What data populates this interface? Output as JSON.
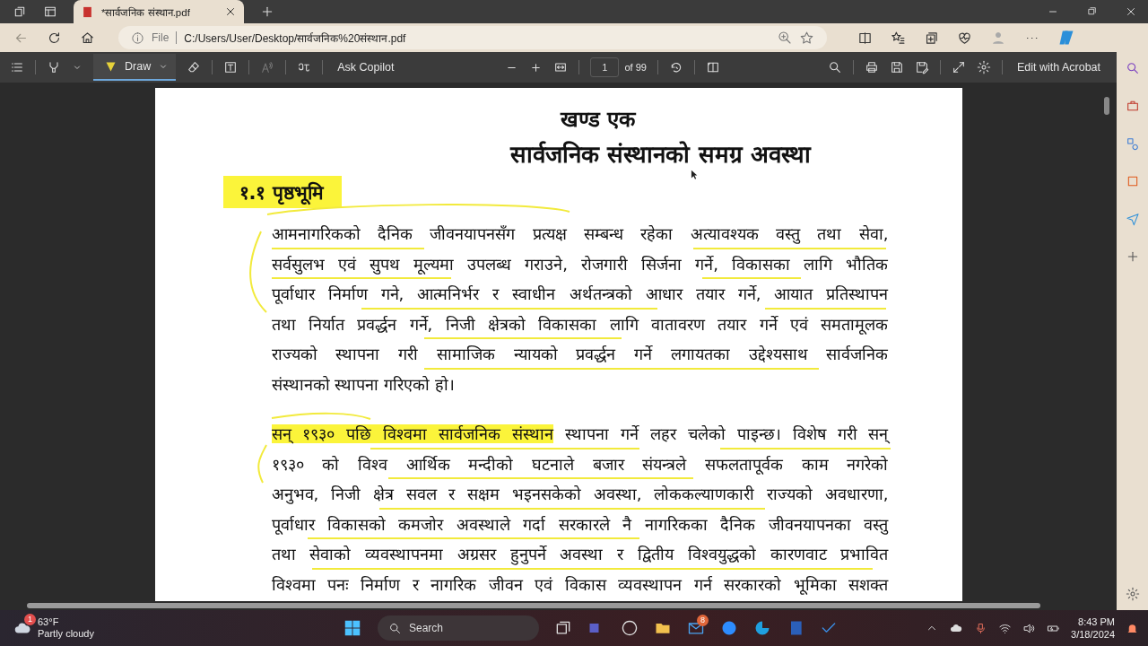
{
  "browser": {
    "tabs": [
      {
        "title": "*सार्वजनिक संस्थान.pdf",
        "selected": true
      }
    ],
    "address": {
      "scheme": "File",
      "url": "C:/Users/User/Desktop/सार्वजनिक%20संस्थान.pdf"
    }
  },
  "pdf_toolbar": {
    "draw": {
      "label": "Draw",
      "selected": true
    },
    "ask_copilot": "Ask Copilot",
    "page": "1",
    "page_count": "of 99",
    "edit_button": "Edit with Acrobat"
  },
  "document": {
    "headings": [
      "खण्ड एक",
      "सार्वजनिक संस्थानको समग्र अवस्था"
    ],
    "section": {
      "text": "१.१ पृष्ठभूमि",
      "highlighted": true
    },
    "paragraphs": [
      {
        "lines": [
          {
            "justified": true,
            "segments": [
              {
                "text": "आमनागरिकको दैनिक जीवनयापनसँग प्रत्यक्ष सम्बन्ध रहेका अत्यावश्यक वस्तु तथा सेवा,",
                "highlighted": false
              }
            ]
          },
          {
            "justified": true,
            "segments": [
              {
                "text": "सर्वसुलभ एवं सुपथ मूल्यमा उपलब्ध गराउने, रोजगारी सिर्जना गर्ने, विकासका लागि भौतिक",
                "highlighted": false
              }
            ]
          },
          {
            "justified": true,
            "segments": [
              {
                "text": "पूर्वाधार निर्माण गने, आत्मनिर्भर र स्वाधीन अर्थतन्त्रको आधार तयार गर्ने, आयात प्रतिस्थापन",
                "highlighted": false
              }
            ]
          },
          {
            "justified": true,
            "segments": [
              {
                "text": "तथा निर्यात प्रवर्द्धन गर्ने, निजी क्षेत्रको विकासका लागि वातावरण तयार गर्ने एवं समतामूलक",
                "highlighted": false
              }
            ]
          },
          {
            "justified": true,
            "segments": [
              {
                "text": "राज्यको स्थापना गरी सामाजिक न्यायको प्रवर्द्धन गर्ने लगायतका उद्देश्यसाथ सार्वजनिक",
                "highlighted": false
              }
            ]
          },
          {
            "justified": false,
            "segments": [
              {
                "text": "संस्थानको स्थापना गरिएको हो।",
                "highlighted": false
              }
            ]
          }
        ]
      },
      {
        "lines": [
          {
            "justified": true,
            "segments": [
              {
                "text": "सन् १९३० पछि विश्वमा सार्वजनिक संस्थान",
                "highlighted": true
              },
              {
                "text": "स्थापना गर्ने लहर चलेको पाइन्छ। विशेष गरी सन्",
                "highlighted": false
              }
            ]
          },
          {
            "justified": true,
            "segments": [
              {
                "text": "१९३० को विश्व आर्थिक मन्दीको घटनाले बजार संयन्त्रले सफलतापूर्वक काम नगरेको",
                "highlighted": false
              }
            ]
          },
          {
            "justified": true,
            "segments": [
              {
                "text": "अनुभव, निजी क्षेत्र सवल र सक्षम भइनसकेको अवस्था, लोककल्याणकारी राज्यको अवधारणा,",
                "highlighted": false
              }
            ]
          },
          {
            "justified": true,
            "segments": [
              {
                "text": "पूर्वाधार विकासको कमजोर अवस्थाले गर्दा सरकारले नै नागरिकका दैनिक जीवनयापनका वस्तु",
                "highlighted": false
              }
            ]
          },
          {
            "justified": true,
            "segments": [
              {
                "text": "तथा सेवाको व्यवस्थापनमा अग्रसर हुनुपर्ने अवस्था र द्वितीय विश्वयुद्धको कारणवाट प्रभावित",
                "highlighted": false
              }
            ]
          },
          {
            "justified": true,
            "segments": [
              {
                "text": "विश्वमा पनः निर्माण र नागरिक जीवन एवं विकास व्यवस्थापन गर्न सरकारको भूमिका सशक्त",
                "highlighted": false
              }
            ]
          }
        ]
      }
    ]
  },
  "taskbar": {
    "weather": {
      "badge": "1",
      "temperature": "63°F",
      "condition": "Partly cloudy"
    },
    "search": "Search",
    "mail_badge": "8",
    "time": "8:43 PM",
    "date": "3/18/2024"
  }
}
